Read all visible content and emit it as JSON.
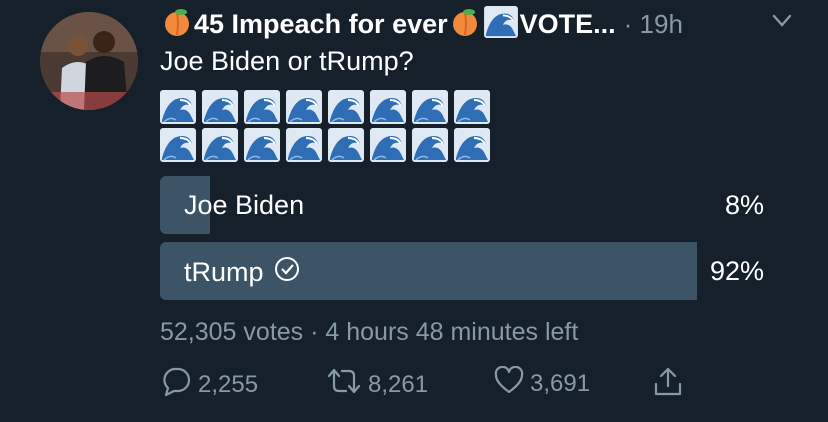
{
  "tweet": {
    "display_name": "45 Impeach for ever",
    "display_name_suffix": "VOTE...",
    "timestamp": "· 19h",
    "text": "Joe Biden or tRump?"
  },
  "poll": {
    "options": [
      {
        "label": "Joe Biden",
        "percent": "8%",
        "fraction": 0.08
      },
      {
        "label": "tRump",
        "percent": "92%",
        "fraction": 0.92
      }
    ],
    "meta": "52,305 votes · 4 hours 48 minutes left"
  },
  "actions": {
    "replies": "2,255",
    "retweets": "8,261",
    "likes": "3,691"
  },
  "icons": [
    "peach-emoji-icon",
    "wave-emoji-icon",
    "chevron-down-icon",
    "check-circle-icon",
    "reply-icon",
    "retweet-icon",
    "like-icon",
    "share-icon"
  ],
  "colors": {
    "background": "#15202b",
    "poll_bar": "#3d5466",
    "muted": "#8899a6"
  }
}
